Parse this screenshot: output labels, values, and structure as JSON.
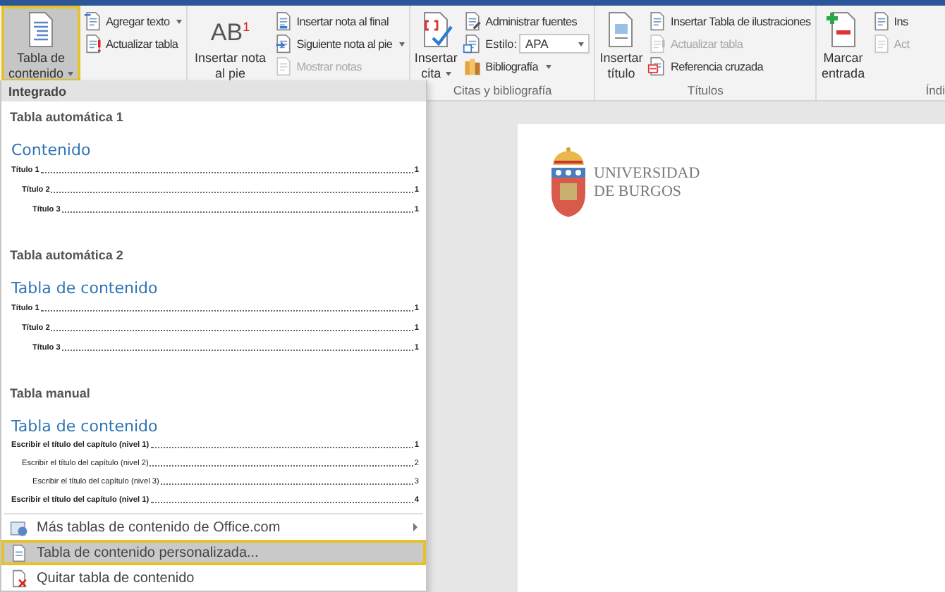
{
  "ribbon": {
    "groups": [
      {
        "large": [
          {
            "label": "Tabla de contenido",
            "dropdown": true,
            "selected": true
          }
        ],
        "small": [
          {
            "kind": "button",
            "label": "Agregar texto",
            "dropdown": true,
            "disabled": false
          },
          {
            "kind": "button",
            "label": "Actualizar tabla",
            "dropdown": false,
            "disabled": false
          }
        ]
      },
      {
        "large": [
          {
            "label": "Insertar nota al pie",
            "glyph": "AB$^{1}$",
            "dropdown": false,
            "selected": false
          }
        ],
        "small": [
          {
            "kind": "button",
            "label": "Insertar nota al final",
            "dropdown": false,
            "disabled": false
          },
          {
            "kind": "button",
            "label": "Siguiente nota al pie",
            "dropdown": true,
            "disabled": false
          },
          {
            "kind": "button",
            "label": "Mostrar notas",
            "dropdown": false,
            "disabled": true
          }
        ]
      },
      {
        "label": "Citas y bibliografía",
        "large": [
          {
            "label": "Insertar cita",
            "dropdown": true,
            "selected": false
          }
        ],
        "small": [
          {
            "kind": "button",
            "label": "Administrar fuentes",
            "dropdown": false,
            "disabled": false
          },
          {
            "kind": "select",
            "label": "Estilo:",
            "value": "APA",
            "disabled": false
          },
          {
            "kind": "button",
            "label": "Bibliografía",
            "dropdown": true,
            "disabled": false
          }
        ]
      },
      {
        "label": "Títulos",
        "large": [
          {
            "label": "Insertar título",
            "dropdown": false,
            "selected": false
          }
        ],
        "small": [
          {
            "kind": "button",
            "label": "Insertar Tabla de ilustraciones",
            "dropdown": false,
            "disabled": false
          },
          {
            "kind": "button",
            "label": "Actualizar tabla",
            "dropdown": false,
            "disabled": true
          },
          {
            "kind": "button",
            "label": "Referencia cruzada",
            "dropdown": false,
            "disabled": false
          }
        ]
      },
      {
        "label": "Índi",
        "large": [
          {
            "label": "Marcar entrada",
            "dropdown": false,
            "selected": false
          }
        ],
        "small": [
          {
            "kind": "button",
            "label": "Ins",
            "dropdown": false,
            "disabled": false
          },
          {
            "kind": "button",
            "label": "Act",
            "dropdown": false,
            "disabled": true
          }
        ]
      }
    ]
  },
  "menu": {
    "header": "Integrado",
    "gallery": [
      {
        "title": "Tabla automática 1",
        "heading": "Contenido",
        "entries": [
          {
            "text": "Título 1",
            "page": "1",
            "bold": true,
            "children": [
              {
                "text": "Título 2",
                "page": "1",
                "bold": true,
                "children": [
                  {
                    "text": "Título 3",
                    "page": "1",
                    "bold": true
                  }
                ]
              }
            ]
          }
        ]
      },
      {
        "title": "Tabla automática 2",
        "heading": "Tabla de contenido",
        "entries": [
          {
            "text": "Título 1",
            "page": "1",
            "bold": true,
            "children": [
              {
                "text": "Título 2",
                "page": "1",
                "bold": true,
                "children": [
                  {
                    "text": "Título 3",
                    "page": "1",
                    "bold": true
                  }
                ]
              }
            ]
          }
        ]
      },
      {
        "title": "Tabla manual",
        "heading": "Tabla de contenido",
        "entries": [
          {
            "text": "Escribir el título del capítulo (nivel 1)",
            "page": "1",
            "bold": true,
            "children": [
              {
                "text": "Escribir el título del capítulo (nivel 2)",
                "page": "2",
                "bold": false,
                "children": [
                  {
                    "text": "Escribir el título del capítulo (nivel 3)",
                    "page": "3",
                    "bold": false
                  }
                ]
              }
            ]
          },
          {
            "text": "Escribir el título del capítulo (nivel 1)",
            "page": "4",
            "bold": true
          }
        ]
      }
    ],
    "commands": [
      {
        "label": "Más tablas de contenido de Office.com",
        "submenu": true,
        "selected": false
      },
      {
        "label": "Tabla de contenido personalizada...",
        "submenu": false,
        "selected": true
      },
      {
        "label": "Quitar tabla de contenido",
        "submenu": false,
        "selected": false
      }
    ]
  },
  "document": {
    "logo_lines": [
      "UNIVERSIDAD",
      "DE BURGOS"
    ]
  }
}
